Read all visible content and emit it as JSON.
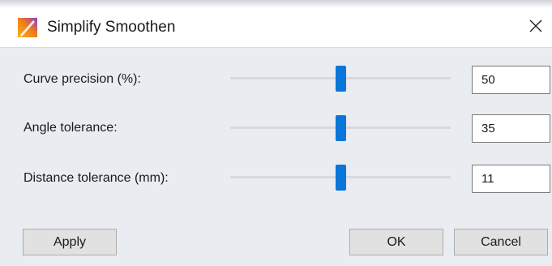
{
  "window": {
    "title": "Simplify Smoothen",
    "icon": "app-logo-icon",
    "close_icon": "close-icon"
  },
  "rows": [
    {
      "label": "Curve precision (%):",
      "value": "50",
      "slider_position": 0.5
    },
    {
      "label": "Angle tolerance:",
      "value": "35",
      "slider_position": 0.5
    },
    {
      "label": "Distance tolerance (mm):",
      "value": "11",
      "slider_position": 0.5
    }
  ],
  "buttons": {
    "apply": "Apply",
    "ok": "OK",
    "cancel": "Cancel"
  },
  "colors": {
    "accent": "#0a76d8",
    "dialog_bg": "#e9ecf1",
    "button_bg": "#e1e1e1"
  }
}
